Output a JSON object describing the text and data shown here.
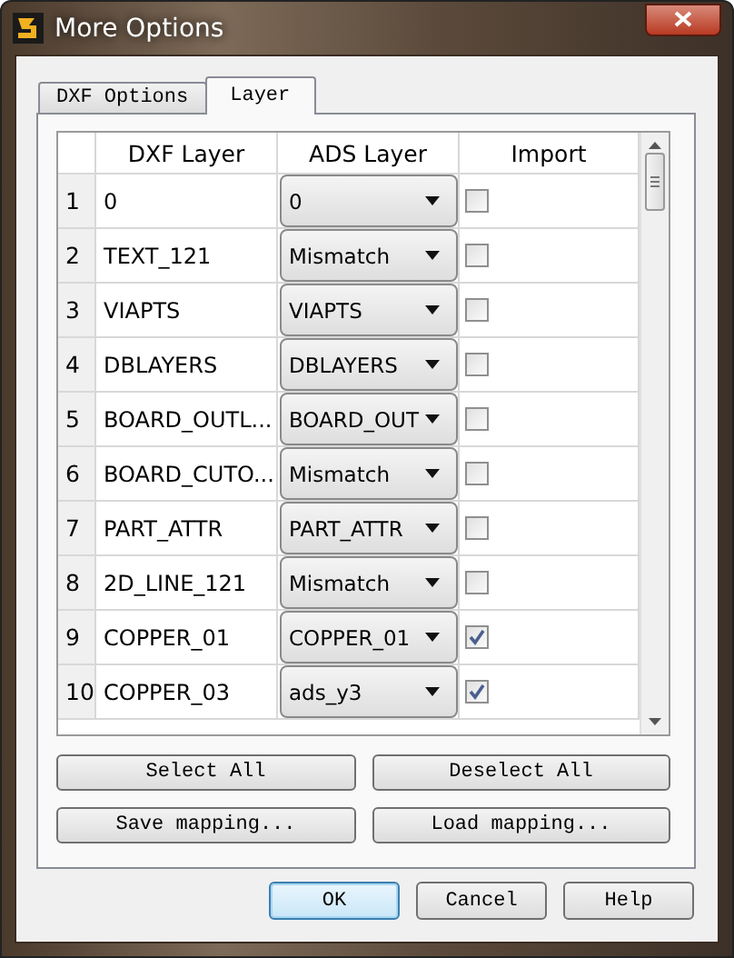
{
  "window": {
    "title": "More Options"
  },
  "tabs": [
    {
      "label": "DXF Options",
      "selected": false
    },
    {
      "label": "Layer",
      "selected": true
    }
  ],
  "table": {
    "columns": [
      "DXF Layer",
      "ADS Layer",
      "Import"
    ],
    "rows": [
      {
        "number": "1",
        "dxf_layer": "0",
        "ads_layer": "0",
        "import": false
      },
      {
        "number": "2",
        "dxf_layer": "TEXT_121",
        "ads_layer": "Mismatch",
        "import": false
      },
      {
        "number": "3",
        "dxf_layer": "VIAPTS",
        "ads_layer": "VIAPTS",
        "import": false
      },
      {
        "number": "4",
        "dxf_layer": "DBLAYERS",
        "ads_layer": "DBLAYERS",
        "import": false
      },
      {
        "number": "5",
        "dxf_layer": "BOARD_OUTL...",
        "ads_layer": "BOARD_OUT",
        "import": false
      },
      {
        "number": "6",
        "dxf_layer": "BOARD_CUTO...",
        "ads_layer": "Mismatch",
        "import": false
      },
      {
        "number": "7",
        "dxf_layer": "PART_ATTR",
        "ads_layer": "PART_ATTR",
        "import": false
      },
      {
        "number": "8",
        "dxf_layer": "2D_LINE_121",
        "ads_layer": "Mismatch",
        "import": false
      },
      {
        "number": "9",
        "dxf_layer": "COPPER_01",
        "ads_layer": "COPPER_01",
        "import": true
      },
      {
        "number": "10",
        "dxf_layer": "COPPER_03",
        "ads_layer": "ads_y3",
        "import": true
      }
    ]
  },
  "buttons": [
    "Select All",
    "Deselect All",
    "Save mapping...",
    "Load mapping..."
  ],
  "dialog_buttons": [
    {
      "label": "OK",
      "default": true
    },
    {
      "label": "Cancel",
      "default": false
    },
    {
      "label": "Help",
      "default": false
    }
  ]
}
